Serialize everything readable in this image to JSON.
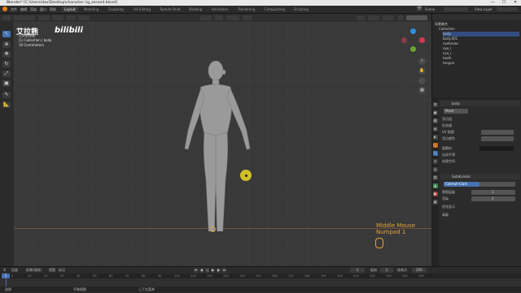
{
  "window": {
    "title": "Blender* [C:\\Users\\dav\\Desktop\\character rig_second.blend]",
    "minimize": "—",
    "maximize": "☐",
    "close": "✕"
  },
  "watermark": {
    "channel": "艾拉熊",
    "platform": "bilibili"
  },
  "menus": [
    "文件",
    "编辑",
    "渲染",
    "窗口",
    "帮助"
  ],
  "workspaces": [
    "Layout",
    "Modeling",
    "Sculpting",
    "UV Editing",
    "Texture Paint",
    "Shading",
    "Animation",
    "Rendering",
    "Compositing",
    "Scripting"
  ],
  "scene": {
    "label": "Scene",
    "view_layer": "View Layer"
  },
  "viewport": {
    "info_lines": [
      "正交前视图",
      "(1) Collection | body",
      "10 Centimeters"
    ],
    "overlay_lines": [
      "Middle Mouse",
      "Numpad 1"
    ]
  },
  "outliner": {
    "rows": [
      "场景集合",
      "Collection",
      "body",
      "body.001",
      "eyebrows",
      "eye_l",
      "eye_r",
      "teeth",
      "tongue"
    ]
  },
  "properties": {
    "object_name": "body",
    "mesh_name": "Mesh",
    "rows": [
      "顶点组",
      "形态键",
      "UV 贴图",
      "顶点颜色",
      "面朝向",
      "自动平滑",
      "纹理空间"
    ],
    "subdivision": "Subdivision",
    "subdiv_rows": [
      "Catmull-Clark",
      "视图层级",
      "渲染"
    ],
    "subdiv_values": [
      "1",
      "2"
    ],
    "opt_rows": [
      "优化显示",
      "高级"
    ]
  },
  "timeline": {
    "menus": [
      "回放",
      "抠像(插帧)",
      "视图",
      "标记"
    ],
    "frame_current": "1",
    "start_label": "起始",
    "start": "1",
    "end_label": "结束点",
    "end": "250",
    "ticks": [
      "0",
      "10",
      "20",
      "30",
      "40",
      "50",
      "60",
      "70",
      "80",
      "90",
      "100",
      "110",
      "120",
      "130",
      "140",
      "150",
      "160",
      "170",
      "180",
      "190",
      "200",
      "210",
      "220",
      "230",
      "240",
      "250"
    ]
  },
  "status": {
    "left": "选择",
    "mid": "平移视图",
    "right": "上下文菜单"
  },
  "colors": {
    "accent": "#4772b3",
    "highlight_orange": "#e5a23a"
  }
}
